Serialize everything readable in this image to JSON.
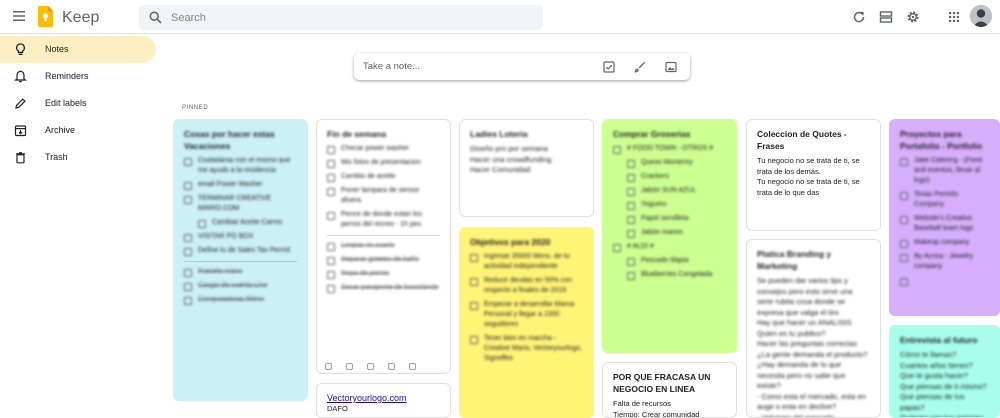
{
  "app": {
    "title": "Keep"
  },
  "search": {
    "placeholder": "Search"
  },
  "sidebar": {
    "items": [
      {
        "label": "Notes",
        "icon": "lightbulb-icon",
        "active": true
      },
      {
        "label": "Reminders",
        "icon": "bell-icon"
      },
      {
        "label": "Edit labels",
        "icon": "pencil-icon"
      },
      {
        "label": "Archive",
        "icon": "archive-icon"
      },
      {
        "label": "Trash",
        "icon": "trash-icon"
      }
    ]
  },
  "take_note": {
    "placeholder": "Take a note..."
  },
  "section": {
    "pinned": "PINNED"
  },
  "colors": {
    "accent": "#fbbc04",
    "active_nav": "#feefc3",
    "blue": "#cbf0f8",
    "yellow": "#fff475",
    "green": "#ccff90",
    "purple": "#d7aefb",
    "teal": "#a7ffeb"
  },
  "notes": {
    "vacaciones": {
      "title": "Cosas por hacer estas Vacaciones",
      "items": [
        "Ciudadania con el mismo que me ayudo a la residencia",
        "email Power Washer",
        "TERMINAR CREATIVE MARIO.COM",
        "Cambiar Aceite Carros",
        "VISITAR PO BOX",
        "Define tu de Sales Tax Permit"
      ],
      "done": [
        "Frasello mano",
        "Cargar de cuenta Lino",
        "Computadoras Ritmo"
      ]
    },
    "fin_semana": {
      "title": "Fin de semana",
      "items": [
        "Checar power washer",
        "Mis fotos de presentacion",
        "Cambio de aceite",
        "Poner lampara de sensor afuera",
        "Pence de donde estan los perros del recreo - 1h pes"
      ],
      "done": [
        "Limpiar mi cuarto",
        "Reparar goteteo de baño",
        "Ropa de perros",
        "Sacar pasaporte de bosorlando"
      ]
    },
    "loteria": {
      "title": "Ladies Loteria",
      "body": "Diseño pro por semana\nHacer una crowdfunding\nHacer Comunidad"
    },
    "objetivos": {
      "title": "Objetivos para 2020",
      "items": [
        "Ingresar 35000 Mens. de tu actividad independiente",
        "Reducir deudas en 50% con respecto a finales de 2019",
        "Empezar a desarrollar Marca Personal y llegar a 1000 seguidores",
        "Tener bien en marcha - Creative Mario, Vectoryourlogo, Signoffex"
      ]
    },
    "groserias": {
      "title": "Comprar Groserias",
      "items": [
        "# FOOD TOWN - OTROS #",
        "Queso Monterey",
        "Crackers",
        "Jabón SUN AZUL",
        "Yogures",
        "Papel servilleta",
        "Jabón manos",
        "# ALDI #",
        "Pescado tilapia",
        "Blueberries Congelada"
      ]
    },
    "quotes": {
      "title": "Coleccion de Quotes - Frases",
      "body": "Tu negocio no se trata de ti, se trata de los demás.\nTu negocio no se trata de ti, se trata de lo que das"
    },
    "branding": {
      "title": "Platica Branding y Marketing",
      "body": "Se pueden dar varios tips y consejos pero esto sirve una serie rubita cosa donde se expresa que valga el tiro\nHay que hacer un ANALISIS\nQuien es tu publico?\nHacer las preguntas correctas\n¿La gente demanda el producto?\n¿Hay demanda de lo que necesita pero no sabe que existe?\n- Como esta el mercado, esta en auge o esta en declive?\n- Volumen del mercado,"
    },
    "fracasa": {
      "title": "POR QUE FRACASA UN NEGOCIO EN LINEA",
      "body": "Falta de recursos\nTiempo: Crear comunidad"
    },
    "vector": {
      "link": "Vectoryourlogo.com",
      "body": "DAFO"
    },
    "proyectos": {
      "title": "Proyectos para Portafolio - Portfolio",
      "items": [
        "Jabe Catering - (Food and eventos, llevar al logo)",
        "Texas Permits Company",
        "Website's Creative Baseball team logo",
        "Makeup company",
        "By Acrisa - Jewelry company",
        ""
      ]
    },
    "entrevista": {
      "title": "Entrevista al futuro",
      "body": "Cómo te llamas?\nCuantos años tienes?\nQue te gusta hacer?\nQue piensas de ti mismo?\nQue piensas de tus papas?\nQuienes son tus mejores"
    }
  }
}
